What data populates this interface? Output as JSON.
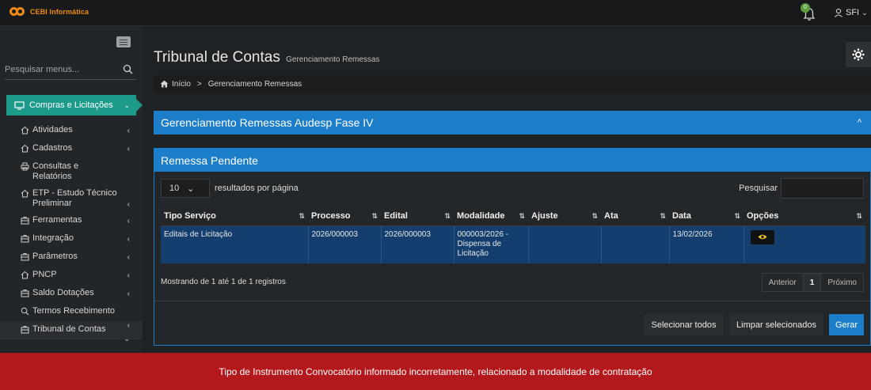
{
  "app": {
    "brand": "CEBI Informática",
    "user": "SFI",
    "notification_count": "0"
  },
  "sidebar": {
    "search_placeholder": "Pesquisar menus...",
    "active_section": "Compras e Licitações",
    "items": [
      {
        "label": "Atividades",
        "icon": "home-icon"
      },
      {
        "label": "Cadastros",
        "icon": "home-icon"
      },
      {
        "label": "Consultas e Relatórios",
        "icon": "print-icon"
      },
      {
        "label": "ETP - Estudo Técnico Preliminar",
        "icon": "home-icon"
      },
      {
        "label": "Ferramentas",
        "icon": "briefcase-icon"
      },
      {
        "label": "Integração",
        "icon": "briefcase-icon"
      },
      {
        "label": "Parâmetros",
        "icon": "briefcase-icon"
      },
      {
        "label": "PNCP",
        "icon": "home-icon"
      },
      {
        "label": "Saldo Dotações",
        "icon": "briefcase-icon"
      },
      {
        "label": "Termos Recebimento",
        "icon": "search-icon"
      },
      {
        "label": "Tribunal de Contas",
        "icon": "briefcase-icon"
      }
    ]
  },
  "header": {
    "title": "Tribunal de Contas",
    "subtitle": "Gerenciamento Remessas"
  },
  "breadcrumb": {
    "home": "Início",
    "separator": ">",
    "current": "Gerenciamento Remessas"
  },
  "panel": {
    "title": "Gerenciamento Remessas Audesp Fase IV"
  },
  "card": {
    "title": "Remessa Pendente",
    "page_length": "10",
    "page_length_label": "resultados por página",
    "search_label": "Pesquisar",
    "columns": [
      "Tipo Serviço",
      "Processo",
      "Edital",
      "Modalidade",
      "Ajuste",
      "Ata",
      "Data",
      "Opções"
    ],
    "rows": [
      {
        "tipo": "Editais de Licitação",
        "processo": "2026/000003",
        "edital": "2026/000003",
        "modalidade": "000003/2026 - Dispensa de Licitação",
        "ajuste": "",
        "ata": "",
        "data": "13/02/2026"
      }
    ],
    "info": "Mostrando de 1 até 1 de 1 registros",
    "pager": {
      "prev": "Anterior",
      "current": "1",
      "next": "Próximo"
    },
    "buttons": {
      "select_all": "Selecionar todos",
      "clear": "Limpar selecionados",
      "generate": "Gerar"
    }
  },
  "alert": {
    "message": "Tipo de Instrumento Convocatório informado incorretamente, relacionado a modalidade de contratação"
  },
  "colors": {
    "accent": "#1c7ec8",
    "active_menu": "#1d9a8a",
    "alert": "#b3191c",
    "brand": "#f28a12"
  }
}
